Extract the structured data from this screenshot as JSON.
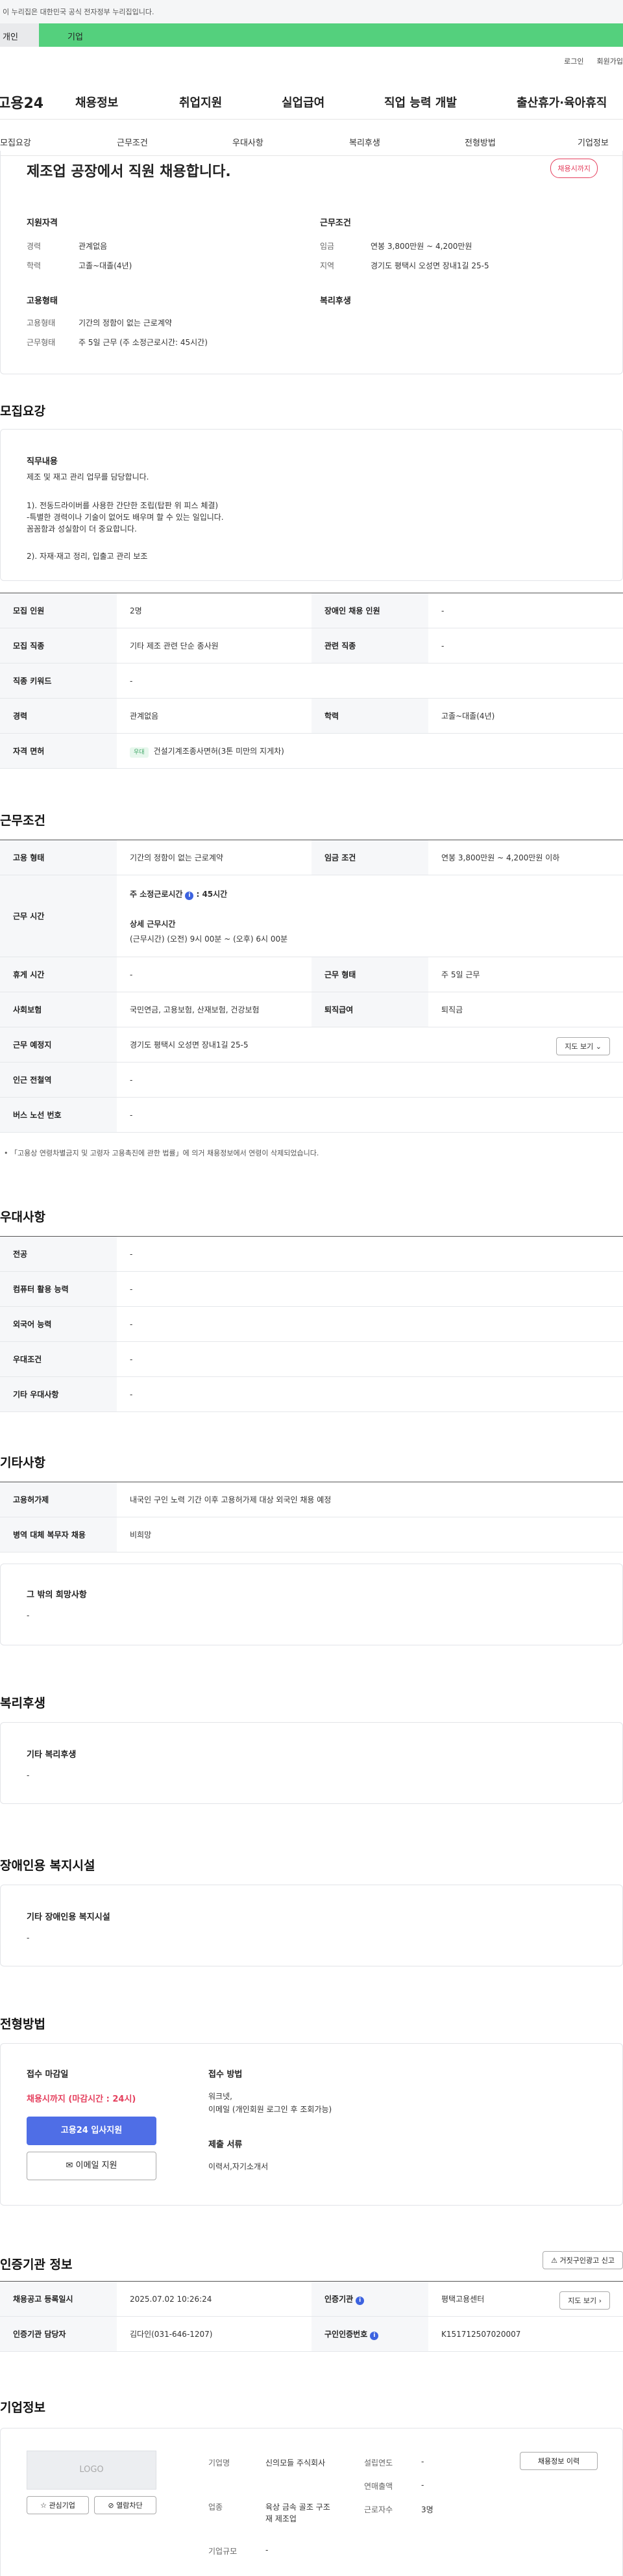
{
  "notice": "이 누리집은 대한민국 공식 전자정부 누리집입니다.",
  "tabs": {
    "individual": "개인",
    "business": "기업"
  },
  "util": {
    "login": "로그인",
    "signup": "회원가입"
  },
  "gnb": {
    "logo": "고용24",
    "menu": [
      "채용정보",
      "취업지원",
      "실업급여",
      "직업 능력 개발",
      "출산휴가·육아휴직"
    ]
  },
  "subnav": [
    "모집요강",
    "근무조건",
    "우대사항",
    "복리후생",
    "전형방법",
    "기업정보"
  ],
  "summary": {
    "title": "제조업 공장에서 직원 채용합니다.",
    "badge": "채용시까지",
    "qual_title": "지원자격",
    "career_label": "경력",
    "career_value": "관계없음",
    "edu_label": "학력",
    "edu_value": "고졸~대졸(4년)",
    "emp_title": "고용형태",
    "emptype_label": "고용형태",
    "emptype_value": "기간의 정함이 없는 근로계약",
    "worktype_label": "근무형태",
    "worktype_value": "주 5일 근무 (주 소정근로시간: 45시간)",
    "cond_title": "근무조건",
    "wage_label": "임금",
    "wage_value": "연봉 3,800만원 ~ 4,200만원",
    "region_label": "지역",
    "region_value": "경기도 평택시 오성면 장내1길 25-5",
    "welfare_title": "복리후생"
  },
  "recruit": {
    "heading": "모집요강",
    "duty_title": "직무내용",
    "duty_lines": [
      "제조 및 재고 관리 업무를 담당합니다.",
      "1). 전동드라이버를 사용한 간단한 조립(탑판 위 피스 체결)",
      "-특별한 경력이나 기술이 없어도 배우며 할 수 있는 일입니다.",
      "꼼꼼함과 성실함이 더 중요합니다.",
      "2). 자재·재고 정리, 입출고 관리 보조"
    ],
    "headcount_label": "모집 인원",
    "headcount_value": "2명",
    "disabled_label": "장애인 채용 인원",
    "disabled_value": "-",
    "job_label": "모집 직종",
    "job_value": "기타 제조 관련 단순 종사원",
    "related_label": "관련 직종",
    "related_value": "-",
    "keyword_label": "직종 키워드",
    "keyword_value": "-",
    "career_label": "경력",
    "career_value": "관계없음",
    "edu_label": "학력",
    "edu_value": "고졸~대졸(4년)",
    "license_label": "자격 면허",
    "license_tag": "우대",
    "license_value": "건설기계조종사면허(3톤 미만의 지게차)"
  },
  "conditions": {
    "heading": "근무조건",
    "emptype_label": "고용 형태",
    "emptype_value": "기간의 정함이 없는 근로계약",
    "wage_label": "임금 조건",
    "wage_value": "연봉 3,800만원 ~ 4,200만원 이하",
    "hours_label": "근무 시간",
    "hours_week_label": "주 소정근로시간",
    "hours_week_value": ": 45시간",
    "hours_detail_label": "상세 근무시간",
    "hours_detail_value": "(근무시간) (오전) 9시 00분 ~ (오후) 6시 00분",
    "rest_label": "휴게 시간",
    "rest_value": "-",
    "worktype_label": "근무 형태",
    "worktype_value": "주 5일 근무",
    "insurance_label": "사회보험",
    "insurance_value": "국민연금, 고용보험, 산재보험, 건강보험",
    "severance_label": "퇴직급여",
    "severance_value": "퇴직금",
    "place_label": "근무 예정지",
    "place_value": "경기도 평택시 오성면 장내1길 25-5",
    "map_btn": "지도 보기",
    "subway_label": "인근 전철역",
    "subway_value": "-",
    "bus_label": "버스 노선 번호",
    "bus_value": "-",
    "note": "「고용상 연령차별금지 및 고령자 고용촉진에 관한 법률」에 의거 채용정보에서 연령이 삭제되었습니다."
  },
  "preference": {
    "heading": "우대사항",
    "rows": [
      {
        "label": "전공",
        "value": "-"
      },
      {
        "label": "컴퓨터 활용 능력",
        "value": "-"
      },
      {
        "label": "외국어 능력",
        "value": "-"
      },
      {
        "label": "우대조건",
        "value": "-"
      },
      {
        "label": "기타 우대사항",
        "value": "-"
      }
    ]
  },
  "etc": {
    "heading": "기타사항",
    "foreign_label": "고용허가제",
    "foreign_value": "내국인 구인 노력 기간 이후 고용허가제 대상 외국인 채용 예정",
    "military_label": "병역 대체 복무자 채용",
    "military_value": "비희망",
    "other_title": "그 밖의 희망사항",
    "other_value": "-"
  },
  "welfare": {
    "heading": "복리후생",
    "title": "기타 복리후생",
    "value": "-"
  },
  "disabled": {
    "heading": "장애인용 복지시설",
    "title": "기타 장애인용 복지시설",
    "value": "-"
  },
  "selection": {
    "heading": "전형방법",
    "deadline_label": "접수 마감일",
    "deadline_value": "채용시까지 (마감시간 : 24시)",
    "apply_btn": "고용24 입사지원",
    "email_btn": "이메일 지원",
    "method_label": "접수 방법",
    "method_value1": "워크넷,",
    "method_value2": "이메일 (개인회원 로그인 후 조회가능)",
    "docs_label": "제출 서류",
    "docs_value": "이력서,자기소개서"
  },
  "agency": {
    "heading": "인증기관 정보",
    "report_btn": "거짓구인광고 신고",
    "regdate_label": "채용공고 등록일시",
    "regdate_value": "2025.07.02 10:26:24",
    "org_label": "인증기관",
    "org_value": "평택고용센터",
    "map_btn": "지도 보기",
    "manager_label": "인증기관 담당자",
    "manager_value": "김다인(031-646-1207)",
    "number_label": "구인인증번호",
    "number_value": "K151712507020007"
  },
  "company": {
    "heading": "기업정보",
    "logo_text": "LOGO",
    "fav_btn": "관심기업",
    "block_btn": "열람차단",
    "name_label": "기업명",
    "name_value": "신의모들 주식회사",
    "founded_label": "설립연도",
    "founded_value": "-",
    "industry_label": "업종",
    "industry_value": "육상 금속 골조 구조재 제조업",
    "sales_label": "연매출액",
    "sales_value": "-",
    "employees_label": "근로자수",
    "employees_value": "3명",
    "size_label": "기업규모",
    "size_value": "-",
    "history_btn": "채용정보 이력"
  }
}
